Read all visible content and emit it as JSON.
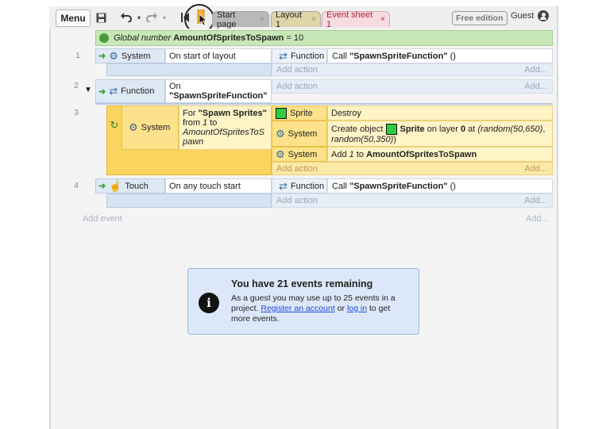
{
  "toolbar": {
    "menu_label": "Menu",
    "tabs": [
      {
        "label": "Start page",
        "close": "×"
      },
      {
        "label": "Layout 1",
        "close": "×"
      },
      {
        "label": "Event sheet 1",
        "close": "×"
      }
    ],
    "badge": "Free edition",
    "user_label": "Guest"
  },
  "global_var": {
    "prefix": "Global number",
    "name": "AmountOfSpritesToSpawn",
    "suffix": "= 10"
  },
  "events": [
    {
      "num": "1",
      "cond_object": "System",
      "cond_text": "On start of layout",
      "actions": [
        {
          "object": "Function",
          "text_pre": "Call",
          "text_bold": "\"SpawnSpriteFunction\"",
          "text_post": "()"
        }
      ]
    },
    {
      "num": "2",
      "cond_object": "Function",
      "cond_text_line1": "On",
      "cond_text_line2": "\"SpawnSpriteFunction\""
    },
    {
      "num": "3",
      "cond_object": "System",
      "loop_line1_pre": "For",
      "loop_line1_bold": "\"Spawn Sprites\"",
      "loop_line2_pre": "from",
      "loop_line2_italic": "1",
      "loop_line2_post": "to",
      "loop_line3": "AmountOfSpritesToS",
      "loop_line4": "pawn",
      "actions": [
        {
          "object": "Sprite",
          "text": "Destroy"
        },
        {
          "object": "System",
          "pre": "Create object",
          "obj": "Sprite",
          "mid": "on layer",
          "layer": "0",
          "at": "at",
          "x": "(random(50,650)",
          "comma": ",",
          "y": "random(50,350)",
          "close": ")"
        },
        {
          "object": "System",
          "pre": "Add",
          "num": "1",
          "to": "to",
          "var": "AmountOfSpritesToSpawn"
        }
      ]
    },
    {
      "num": "4",
      "cond_object": "Touch",
      "cond_text": "On any touch start",
      "actions": [
        {
          "object": "Function",
          "text_pre": "Call",
          "text_bold": "\"SpawnSpriteFunction\"",
          "text_post": "()"
        }
      ]
    }
  ],
  "add_action": "Add action",
  "add_short": "Add...",
  "add_event": "Add event",
  "info": {
    "title": "You have 21 events remaining",
    "line1": "As a guest you may use up to 25 events in a",
    "line2_pre": "project.",
    "register": "Register an account",
    "or": "or",
    "login": "log in",
    "line2_post": "to get",
    "line3": "more events."
  },
  "colors": {
    "accent_green": "#2ecc40",
    "loop_yellow": "#fbd460",
    "info_blue": "#dce8fa"
  }
}
